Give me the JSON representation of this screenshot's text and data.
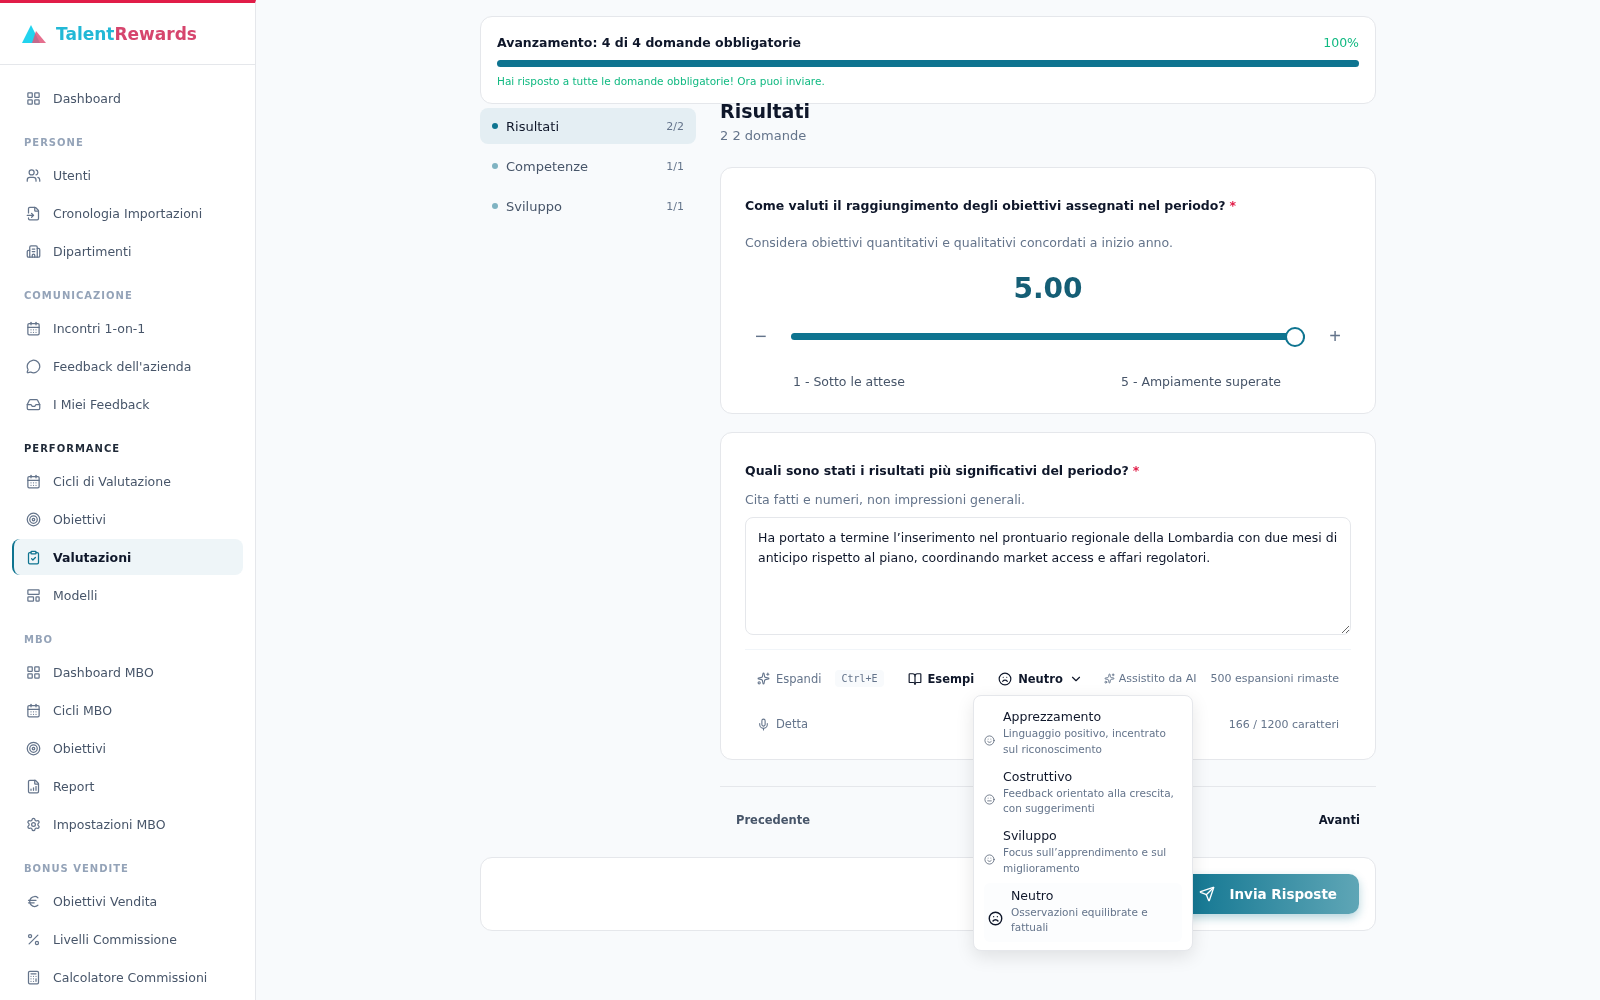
{
  "brand": {
    "name_part1": "Talent",
    "name_part2": "Rewards"
  },
  "sidebar": {
    "sections": [
      {
        "items": [
          {
            "label": "Dashboard",
            "selected": false
          }
        ]
      },
      {
        "title": "PERSONE",
        "active": false,
        "items": [
          {
            "label": "Utenti",
            "selected": false
          },
          {
            "label": "Cronologia Importazioni",
            "selected": false
          },
          {
            "label": "Dipartimenti",
            "selected": false
          }
        ]
      },
      {
        "title": "COMUNICAZIONE",
        "active": false,
        "items": [
          {
            "label": "Incontri 1-on-1",
            "selected": false
          },
          {
            "label": "Feedback dell'azienda",
            "selected": false
          },
          {
            "label": "I Miei Feedback",
            "selected": false
          }
        ]
      },
      {
        "title": "PERFORMANCE",
        "active": true,
        "items": [
          {
            "label": "Cicli di Valutazione",
            "selected": false
          },
          {
            "label": "Obiettivi",
            "selected": false
          },
          {
            "label": "Valutazioni",
            "selected": true
          },
          {
            "label": "Modelli",
            "selected": false
          }
        ]
      },
      {
        "title": "MBO",
        "active": false,
        "items": [
          {
            "label": "Dashboard MBO",
            "selected": false
          },
          {
            "label": "Cicli MBO",
            "selected": false
          },
          {
            "label": "Obiettivi",
            "selected": false
          },
          {
            "label": "Report",
            "selected": false
          },
          {
            "label": "Impostazioni MBO",
            "selected": false
          }
        ]
      },
      {
        "title": "BONUS VENDITE",
        "active": false,
        "items": [
          {
            "label": "Obiettivi Vendita",
            "selected": false
          },
          {
            "label": "Livelli Commissione",
            "selected": false
          },
          {
            "label": "Calcolatore Commissioni",
            "selected": false
          }
        ]
      }
    ]
  },
  "progress": {
    "title": "Avanzamento: 4 di 4 domande obbligatorie",
    "percent": "100%",
    "level": 1,
    "message": "Hai risposto a tutte le domande obbligatorie! Ora puoi inviare."
  },
  "sections_nav": [
    {
      "label": "Risultati",
      "count": "2/2",
      "selected": true
    },
    {
      "label": "Competenze",
      "count": "1/1",
      "selected": false
    },
    {
      "label": "Sviluppo",
      "count": "1/1",
      "selected": false
    }
  ],
  "section": {
    "title": "Risultati",
    "subtitle": "2 2 domande"
  },
  "questions": [
    {
      "kind": "slider",
      "question": "Come valuti il raggiungimento degli obiettivi assegnati nel periodo?",
      "required_mark": "*",
      "hint": "Considera obiettivi quantitativi e qualitativi concordati a inizio anno.",
      "value": "5.00",
      "level": 1,
      "minus": "−",
      "plus": "+",
      "min_label": "1 - Sotto le attese",
      "max_label": "5 - Ampiamente superate"
    },
    {
      "kind": "text",
      "question": "Quali sono stati i risultati più significativi del periodo?",
      "required_mark": "*",
      "hint": "Cita fatti e numeri, non impressioni generali.",
      "value": "Ha portato a termine l’inserimento nel prontuario regionale della Lombardia con due mesi di anticipo rispetto al piano, coordinando market access e affari regolatori.",
      "expand": "Espandi",
      "shortcut": "Ctrl+E",
      "examples": "Esempi",
      "tone": "Neutro",
      "ai_label": "Assistito da AI",
      "ai_remaining": "500 espansioni rimaste",
      "dictate": "Detta",
      "char_count": "166 / 1200 caratteri",
      "tone_menu": {
        "options": [
          {
            "label": "Apprezzamento",
            "description": "Linguaggio positivo, incentrato sul riconoscimento",
            "selected": false
          },
          {
            "label": "Costruttivo",
            "description": "Feedback orientato alla crescita, con suggerimenti",
            "selected": false
          },
          {
            "label": "Sviluppo",
            "description": "Focus sull’apprendimento e sul miglioramento",
            "selected": false
          },
          {
            "label": "Neutro",
            "description": "Osservazioni equilibrate e fattuali",
            "selected": true
          }
        ]
      }
    }
  ],
  "navigation": {
    "previous": "Precedente",
    "next": "Avanti"
  },
  "submit": {
    "label": "Invia Risposte"
  }
}
